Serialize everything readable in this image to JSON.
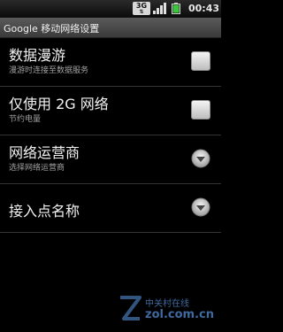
{
  "status_bar": {
    "network_badge": "3G",
    "time": "00:43",
    "icons": [
      "3g-data-icon",
      "signal-bars-icon",
      "battery-icon"
    ]
  },
  "title_bar": {
    "title": "Google 移动网络设置"
  },
  "settings": [
    {
      "label": "数据漫游",
      "summary": "漫游时连接至数据服务",
      "control": "checkbox",
      "checked": true
    },
    {
      "label": "仅使用 2G 网络",
      "summary": "节约电量",
      "control": "checkbox",
      "checked": true
    },
    {
      "label": "网络运营商",
      "summary": "选择网络运营商",
      "control": "chevron"
    },
    {
      "label": "接入点名称",
      "summary": "",
      "control": "chevron"
    }
  ],
  "watermark": {
    "line1": "中关村在线",
    "line2": "zol.com.cn"
  },
  "colors": {
    "background": "#000000",
    "title_bar": "#4a4a4a",
    "status_bar": "#1a1a1a",
    "checkbox_mark": "#1a1a1a",
    "watermark": "#3f6aa0"
  }
}
